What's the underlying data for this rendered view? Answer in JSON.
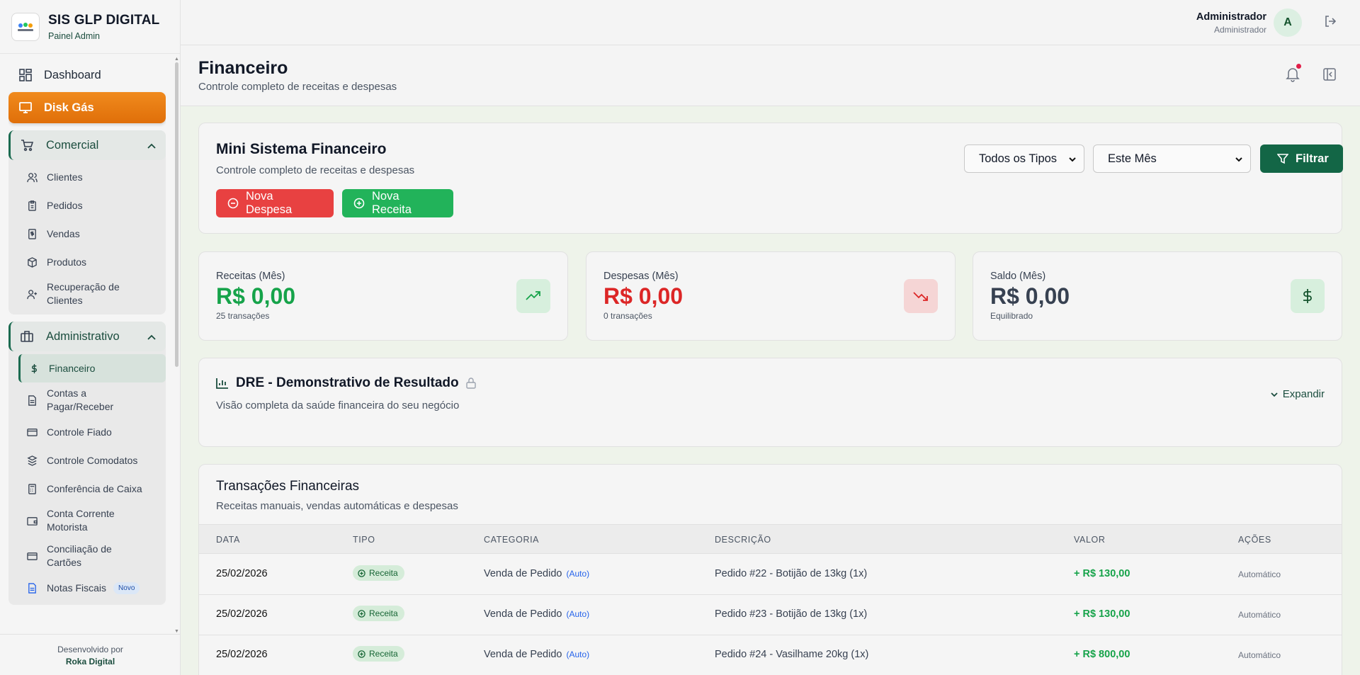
{
  "brand": {
    "title": "SIS GLP DIGITAL",
    "subtitle": "Painel Admin"
  },
  "sidebar": {
    "dashboard": "Dashboard",
    "disk_gas": "Disk Gás",
    "comercial": {
      "label": "Comercial",
      "items": [
        "Clientes",
        "Pedidos",
        "Vendas",
        "Produtos",
        "Recuperação de Clientes"
      ]
    },
    "administrativo": {
      "label": "Administrativo",
      "items": [
        "Financeiro",
        "Contas a Pagar/Receber",
        "Controle Fiado",
        "Controle Comodatos",
        "Conferência de Caixa",
        "Conta Corrente Motorista",
        "Conciliação de Cartões",
        "Notas Fiscais"
      ],
      "badge": "Novo"
    },
    "footer": {
      "line1": "Desenvolvido por",
      "line2": "Roka Digital"
    }
  },
  "topbar": {
    "user_name": "Administrador",
    "user_role": "Administrador",
    "avatar_letter": "A"
  },
  "page": {
    "title": "Financeiro",
    "subtitle": "Controle completo de receitas e despesas"
  },
  "mini": {
    "title": "Mini Sistema Financeiro",
    "subtitle": "Controle completo de receitas e despesas",
    "btn_despesa": "Nova Despesa",
    "btn_receita": "Nova Receita",
    "filter_type": "Todos os Tipos",
    "filter_period": "Este Mês",
    "btn_filtrar": "Filtrar"
  },
  "stats": [
    {
      "label": "Receitas (Mês)",
      "value": "R$ 0,00",
      "note": "25 transações",
      "color": "#16a34a"
    },
    {
      "label": "Despesas (Mês)",
      "value": "R$ 0,00",
      "note": "0 transações",
      "color": "#dc2626"
    },
    {
      "label": "Saldo (Mês)",
      "value": "R$ 0,00",
      "note": "Equilibrado",
      "color": "#374151"
    }
  ],
  "dre": {
    "title": "DRE - Demonstrativo de Resultado",
    "subtitle": "Visão completa da saúde financeira do seu negócio",
    "expand": "Expandir"
  },
  "transactions": {
    "title": "Transações Financeiras",
    "subtitle": "Receitas manuais, vendas automáticas e despesas",
    "columns": [
      "DATA",
      "TIPO",
      "CATEGORIA",
      "DESCRIÇÃO",
      "VALOR",
      "AÇÕES"
    ],
    "rows": [
      {
        "date": "25/02/2026",
        "type": "Receita",
        "category": "Venda de Pedido",
        "auto": "(Auto)",
        "description": "Pedido #22 - Botijão de 13kg (1x)",
        "value": "+ R$ 130,00",
        "action": "Automático"
      },
      {
        "date": "25/02/2026",
        "type": "Receita",
        "category": "Venda de Pedido",
        "auto": "(Auto)",
        "description": "Pedido #23 - Botijão de 13kg (1x)",
        "value": "+ R$ 130,00",
        "action": "Automático"
      },
      {
        "date": "25/02/2026",
        "type": "Receita",
        "category": "Venda de Pedido",
        "auto": "(Auto)",
        "description": "Pedido #24 - Vasilhame 20kg (1x)",
        "value": "+ R$ 800,00",
        "action": "Automático"
      }
    ]
  }
}
